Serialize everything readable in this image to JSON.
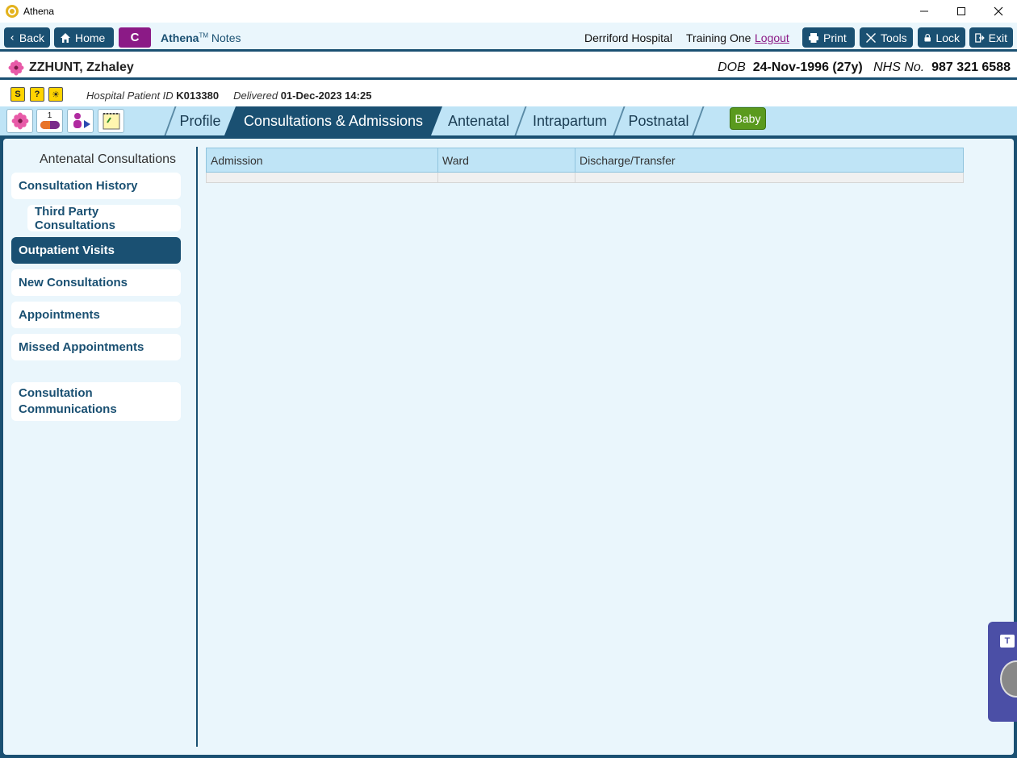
{
  "window": {
    "title": "Athena"
  },
  "nav": {
    "back_label": "Back",
    "home_label": "Home",
    "c_label": "C",
    "brand_name": "Athena",
    "brand_tm": "TM",
    "brand_suffix": "Notes",
    "hospital": "Derriford Hospital",
    "user": "Training One",
    "logout_label": "Logout",
    "print_label": "Print",
    "tools_label": "Tools",
    "lock_label": "Lock",
    "exit_label": "Exit"
  },
  "patient": {
    "name": "ZZHUNT, Zzhaley",
    "dob_label": "DOB",
    "dob_value": "24-Nov-1996 (27y)",
    "nhs_label": "NHS No.",
    "nhs_value": "987 321 6588",
    "hosp_id_label": "Hospital Patient ID",
    "hosp_id_value": "K013380",
    "delivered_label": "Delivered",
    "delivered_value": "01-Dec-2023 14:25"
  },
  "info_icons": [
    {
      "glyph": "S",
      "name": "s-flag-icon"
    },
    {
      "glyph": "?",
      "name": "question-flag-icon"
    },
    {
      "glyph": "☀",
      "name": "sun-flag-icon"
    }
  ],
  "tool_icons": [
    {
      "name": "flower-icon"
    },
    {
      "name": "medication-icon",
      "glyph": "1"
    },
    {
      "name": "person-play-icon"
    },
    {
      "name": "notepad-icon"
    }
  ],
  "tabs": [
    {
      "label": "Profile"
    },
    {
      "label": "Consultations & Admissions",
      "active": true
    },
    {
      "label": "Antenatal"
    },
    {
      "label": "Intrapartum"
    },
    {
      "label": "Postnatal"
    }
  ],
  "baby_label": "Baby",
  "sidebar": {
    "title": "Antenatal Consultations",
    "items": [
      {
        "label": "Consultation History"
      },
      {
        "label": "Third Party Consultations"
      },
      {
        "label": "Outpatient Visits",
        "active": true
      },
      {
        "label": "New Consultations"
      },
      {
        "label": "Appointments"
      },
      {
        "label": "Missed Appointments"
      },
      {
        "label": "Consultation Communications"
      }
    ]
  },
  "table": {
    "columns": [
      "Admission",
      "Ward",
      "Discharge/Transfer"
    ],
    "rows": []
  },
  "colors": {
    "primary": "#1a5072",
    "accent_purple": "#8b1a86",
    "baby_green": "#5a9a1e",
    "background": "#eaf6fc",
    "tab_bar": "#bfe4f6"
  }
}
